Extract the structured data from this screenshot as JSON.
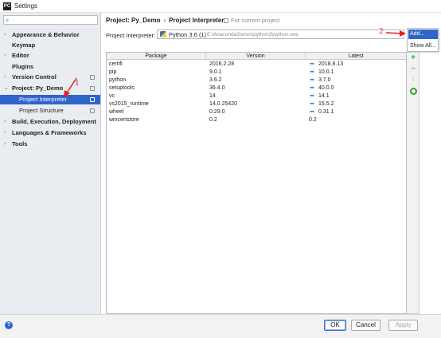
{
  "window": {
    "title": "Settings",
    "app_icon_text": "PC"
  },
  "sidebar": {
    "search_placeholder": "",
    "items": [
      {
        "label": "Appearance & Behavior",
        "arrow": "›",
        "level": 0
      },
      {
        "label": "Keymap",
        "arrow": "",
        "level": 0
      },
      {
        "label": "Editor",
        "arrow": "›",
        "level": 0
      },
      {
        "label": "Plugins",
        "arrow": "",
        "level": 0
      },
      {
        "label": "Version Control",
        "arrow": "›",
        "level": 0
      },
      {
        "label": "Project: Py_Demo",
        "arrow": "⌄",
        "level": 0
      },
      {
        "label": "Project Interpreter",
        "arrow": "",
        "level": 1,
        "selected": true
      },
      {
        "label": "Project Structure",
        "arrow": "",
        "level": 1
      },
      {
        "label": "Build, Execution, Deployment",
        "arrow": "›",
        "level": 0
      },
      {
        "label": "Languages & Frameworks",
        "arrow": "›",
        "level": 0
      },
      {
        "label": "Tools",
        "arrow": "›",
        "level": 0
      }
    ]
  },
  "breadcrumb": {
    "project": "Project: Py_Demo",
    "separator": "›",
    "page": "Project Interpreter",
    "scope_note": "For current project"
  },
  "interpreter": {
    "label": "Project Interpreter:",
    "name": "Python 3.6 (1)",
    "path": "E:\\Anaconda3\\envs\\python3\\python.exe"
  },
  "dropdown": {
    "items": [
      "Add...",
      "Show All..."
    ]
  },
  "table": {
    "headers": [
      "Package",
      "Version",
      "Latest"
    ],
    "rows": [
      {
        "package": "certifi",
        "version": "2016.2.28",
        "latest": "2018.8.13",
        "upgrade": true
      },
      {
        "package": "pip",
        "version": "9.0.1",
        "latest": "10.0.1",
        "upgrade": true
      },
      {
        "package": "python",
        "version": "3.6.2",
        "latest": "3.7.0",
        "upgrade": true
      },
      {
        "package": "setuptools",
        "version": "36.4.0",
        "latest": "40.0.0",
        "upgrade": true
      },
      {
        "package": "vc",
        "version": "14",
        "latest": "14.1",
        "upgrade": true
      },
      {
        "package": "vs2015_runtime",
        "version": "14.0.25420",
        "latest": "15.5.2",
        "upgrade": true
      },
      {
        "package": "wheel",
        "version": "0.29.0",
        "latest": "0.31.1",
        "upgrade": true
      },
      {
        "package": "wincertstore",
        "version": "0.2",
        "latest": "0.2",
        "upgrade": false
      }
    ]
  },
  "toolbar": {
    "add": "+",
    "remove": "−",
    "up": "↑"
  },
  "annotations": {
    "one": "1",
    "two": "2"
  },
  "footer": {
    "help": "?",
    "ok": "OK",
    "cancel": "Cancel",
    "apply": "Apply"
  },
  "colors": {
    "selection": "#2f65ca",
    "annotation": "#e02020",
    "add_green": "#2aa52a",
    "upgrade_arrow": "#3c8dbc"
  }
}
